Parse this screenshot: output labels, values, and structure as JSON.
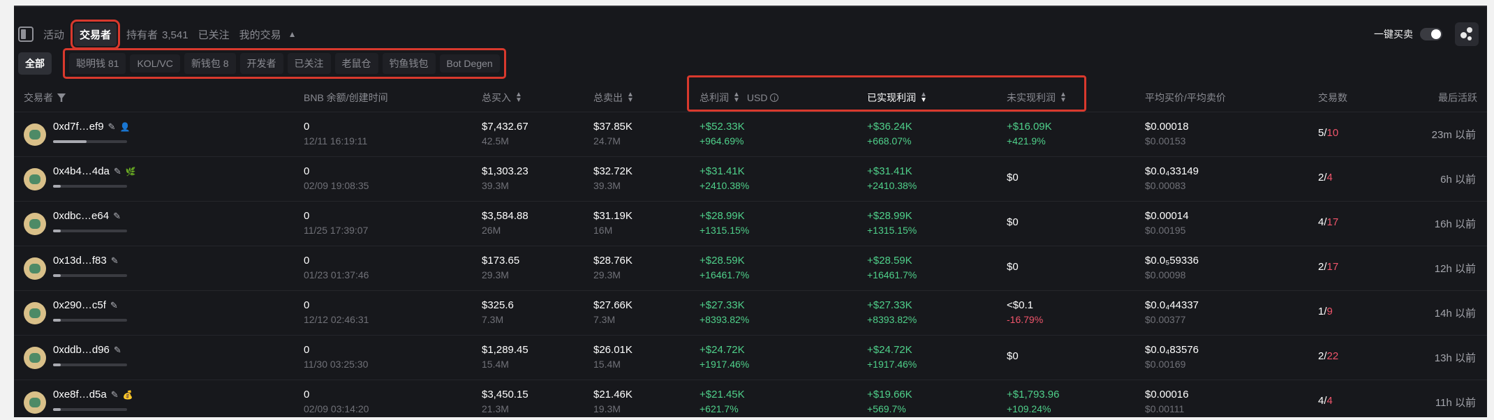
{
  "tabs": {
    "activity": "活动",
    "traders": "交易者",
    "holders": "持有者",
    "holders_count": "3,541",
    "followed": "已关注",
    "my_trades": "我的交易"
  },
  "top_right": {
    "one_click_label": "一键买卖"
  },
  "filters": {
    "all": "全部",
    "chips": [
      "聪明钱 81",
      "KOL/VC",
      "新钱包 8",
      "开发者",
      "已关注",
      "老鼠仓",
      "钓鱼钱包",
      "Bot Degen"
    ]
  },
  "columns": {
    "trader": "交易者",
    "bnb_balance": "BNB 余额/创建时间",
    "bought": "总买入",
    "sold": "总卖出",
    "pnl": "总利润",
    "currency": "USD",
    "realized": "已实现利润",
    "unrealized": "未实现利润",
    "avg_price": "平均买价/平均卖价",
    "trades": "交易数",
    "last_active": "最后活跃"
  },
  "rows": [
    {
      "addr": "0xd7f…ef9",
      "bnb": "0",
      "created": "12/11 16:19:11",
      "bought": "$7,432.67",
      "bought_qty": "42.5M",
      "sold": "$37.85K",
      "sold_qty": "24.7M",
      "pnl": "+$52.33K",
      "pnl_pct": "+964.69%",
      "realized": "+$36.24K",
      "realized_pct": "+668.07%",
      "unrealized": "+$16.09K",
      "unrealized_pct": "+421.9%",
      "avg_buy": "$0.00018",
      "avg_sell": "$0.00153",
      "buys": "5",
      "sells": "10",
      "last": "23m 以前",
      "bar": 0.45
    },
    {
      "addr": "0x4b4…4da",
      "bnb": "0",
      "created": "02/09 19:08:35",
      "bought": "$1,303.23",
      "bought_qty": "39.3M",
      "sold": "$32.72K",
      "sold_qty": "39.3M",
      "pnl": "+$31.41K",
      "pnl_pct": "+2410.38%",
      "realized": "+$31.41K",
      "realized_pct": "+2410.38%",
      "unrealized": "$0",
      "unrealized_pct": "",
      "avg_buy": "$0.0₄33149",
      "avg_sell": "$0.00083",
      "buys": "2",
      "sells": "4",
      "last": "6h 以前",
      "bar": 0.0
    },
    {
      "addr": "0xdbc…e64",
      "bnb": "0",
      "created": "11/25 17:39:07",
      "bought": "$3,584.88",
      "bought_qty": "26M",
      "sold": "$31.19K",
      "sold_qty": "16M",
      "pnl": "+$28.99K",
      "pnl_pct": "+1315.15%",
      "realized": "+$28.99K",
      "realized_pct": "+1315.15%",
      "unrealized": "$0",
      "unrealized_pct": "",
      "avg_buy": "$0.00014",
      "avg_sell": "$0.00195",
      "buys": "4",
      "sells": "17",
      "last": "16h 以前",
      "bar": 0.0
    },
    {
      "addr": "0x13d…f83",
      "bnb": "0",
      "created": "01/23 01:37:46",
      "bought": "$173.65",
      "bought_qty": "29.3M",
      "sold": "$28.76K",
      "sold_qty": "29.3M",
      "pnl": "+$28.59K",
      "pnl_pct": "+16461.7%",
      "realized": "+$28.59K",
      "realized_pct": "+16461.7%",
      "unrealized": "$0",
      "unrealized_pct": "",
      "avg_buy": "$0.0₅59336",
      "avg_sell": "$0.00098",
      "buys": "2",
      "sells": "17",
      "last": "12h 以前",
      "bar": 0.0
    },
    {
      "addr": "0x290…c5f",
      "bnb": "0",
      "created": "12/12 02:46:31",
      "bought": "$325.6",
      "bought_qty": "7.3M",
      "sold": "$27.66K",
      "sold_qty": "7.3M",
      "pnl": "+$27.33K",
      "pnl_pct": "+8393.82%",
      "realized": "+$27.33K",
      "realized_pct": "+8393.82%",
      "unrealized": "<$0.1",
      "unrealized_pct": "-16.79%",
      "avg_buy": "$0.0₄44337",
      "avg_sell": "$0.00377",
      "buys": "1",
      "sells": "9",
      "last": "14h 以前",
      "bar": 0.0
    },
    {
      "addr": "0xddb…d96",
      "bnb": "0",
      "created": "11/30 03:25:30",
      "bought": "$1,289.45",
      "bought_qty": "15.4M",
      "sold": "$26.01K",
      "sold_qty": "15.4M",
      "pnl": "+$24.72K",
      "pnl_pct": "+1917.46%",
      "realized": "+$24.72K",
      "realized_pct": "+1917.46%",
      "unrealized": "$0",
      "unrealized_pct": "",
      "avg_buy": "$0.0₄83576",
      "avg_sell": "$0.00169",
      "buys": "2",
      "sells": "22",
      "last": "13h 以前",
      "bar": 0.0
    },
    {
      "addr": "0xe8f…d5a",
      "bnb": "0",
      "created": "02/09 03:14:20",
      "bought": "$3,450.15",
      "bought_qty": "21.3M",
      "sold": "$21.46K",
      "sold_qty": "19.3M",
      "pnl": "+$21.45K",
      "pnl_pct": "+621.7%",
      "realized": "+$19.66K",
      "realized_pct": "+569.7%",
      "unrealized": "+$1,793.96",
      "unrealized_pct": "+109.24%",
      "avg_buy": "$0.00016",
      "avg_sell": "$0.00111",
      "buys": "4",
      "sells": "4",
      "last": "11h 以前",
      "bar": 0.08
    }
  ]
}
